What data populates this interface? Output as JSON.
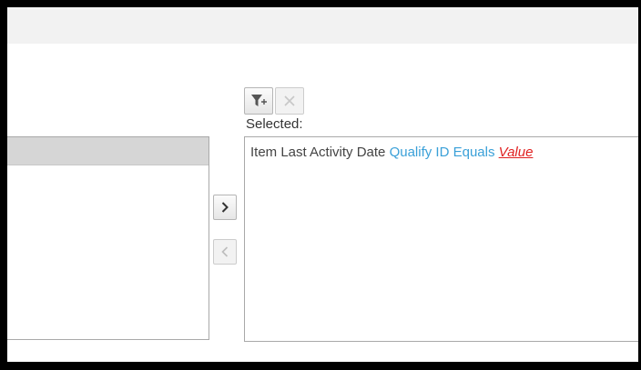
{
  "selected": {
    "label": "Selected:",
    "items": [
      {
        "field": "Item Last Activity Date",
        "qualify": "Qualify ID",
        "operator": "Equals",
        "value": "Value"
      }
    ]
  },
  "toolbar": {
    "add_filter_icon": "filter-plus-icon",
    "remove_icon": "close-icon"
  },
  "move": {
    "right_icon": "chevron-right-icon",
    "left_icon": "chevron-left-icon"
  },
  "colors": {
    "qualify": "#3aa0d8",
    "value": "#e02020",
    "list_header": "#d6d6d6",
    "topbar": "#f2f2f2"
  }
}
